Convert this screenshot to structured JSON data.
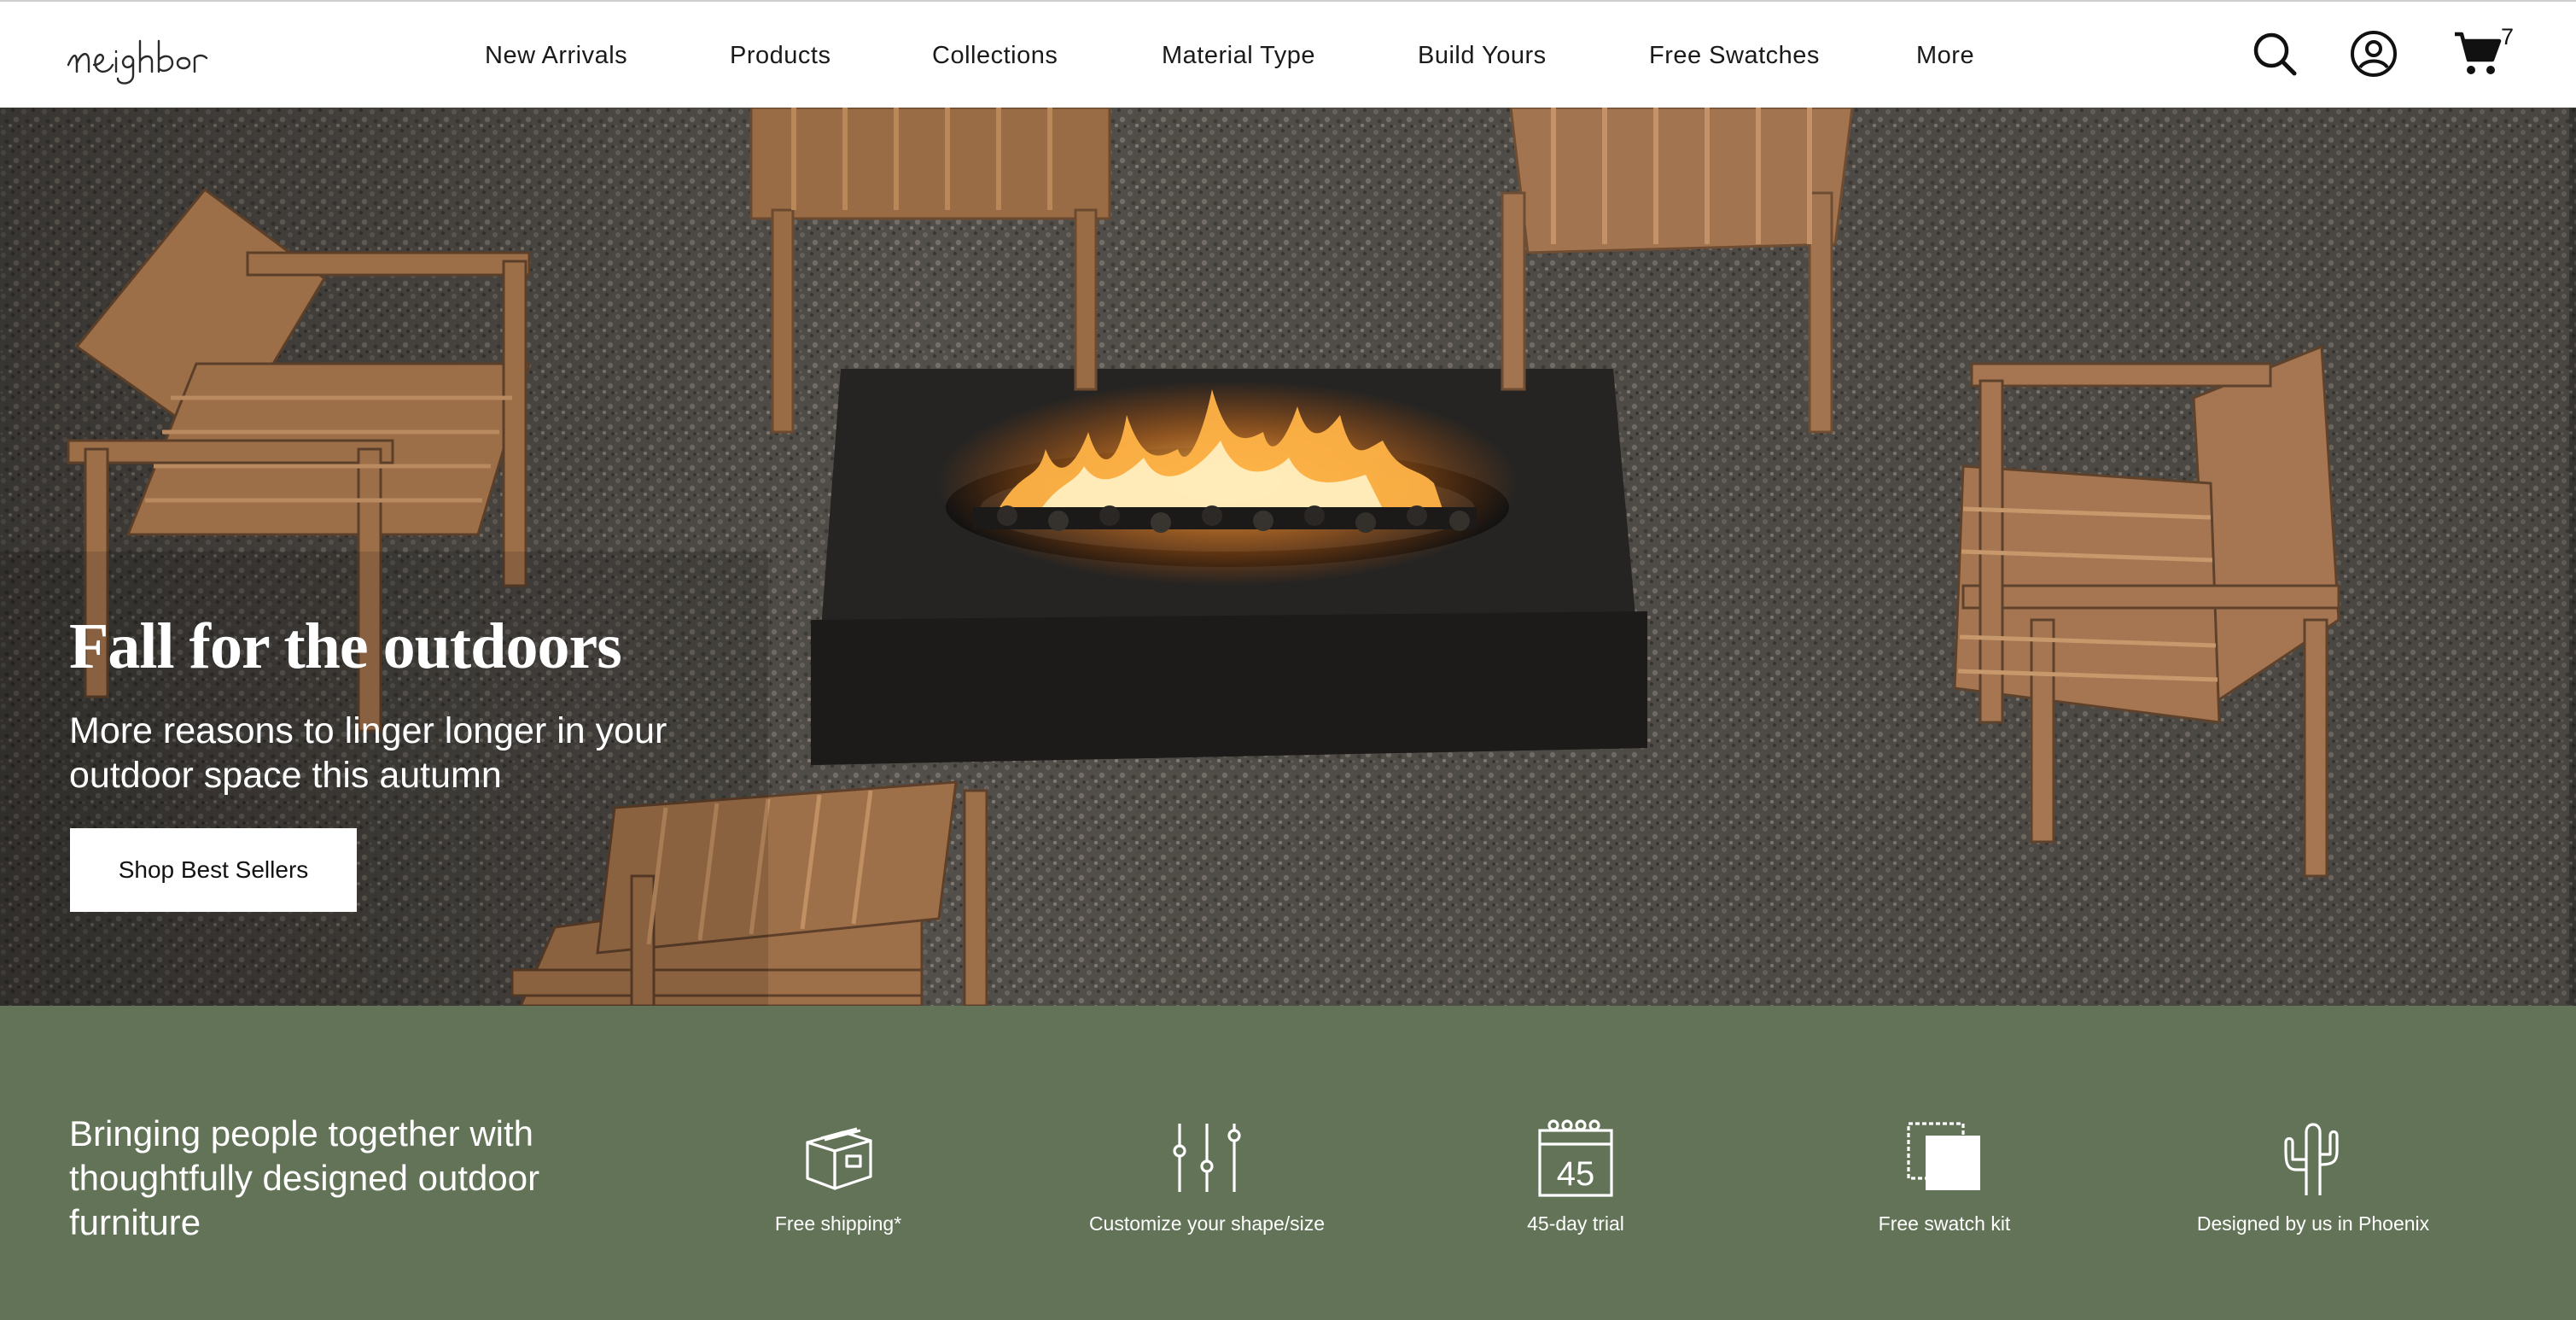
{
  "header": {
    "logo_text": "neighbor",
    "nav": [
      {
        "label": "New Arrivals"
      },
      {
        "label": "Products"
      },
      {
        "label": "Collections"
      },
      {
        "label": "Material Type"
      },
      {
        "label": "Build Yours"
      },
      {
        "label": "Free Swatches"
      },
      {
        "label": "More"
      }
    ],
    "icons": [
      "search-icon",
      "account-icon",
      "cart-icon"
    ],
    "cart_count": "7"
  },
  "hero": {
    "title": "Fall for the outdoors",
    "subtitle": "More reasons to linger longer in your outdoor space this autumn",
    "button_label": "Shop Best Sellers"
  },
  "features": {
    "tagline": "Bringing people together with thoughtfully designed outdoor furniture",
    "items": [
      {
        "icon": "box-icon",
        "label": "Free shipping*"
      },
      {
        "icon": "sliders-icon",
        "label": "Customize your shape/size"
      },
      {
        "icon": "calendar-icon",
        "label": "45-day trial",
        "calendar_number": "45"
      },
      {
        "icon": "swatch-icon",
        "label": "Free swatch kit"
      },
      {
        "icon": "cactus-icon",
        "label": "Designed by us in Phoenix"
      }
    ]
  },
  "colors": {
    "band_green": "#637357",
    "header_bg": "#ffffff",
    "text_dark": "#1a1a1a",
    "text_light": "#ffffff"
  }
}
